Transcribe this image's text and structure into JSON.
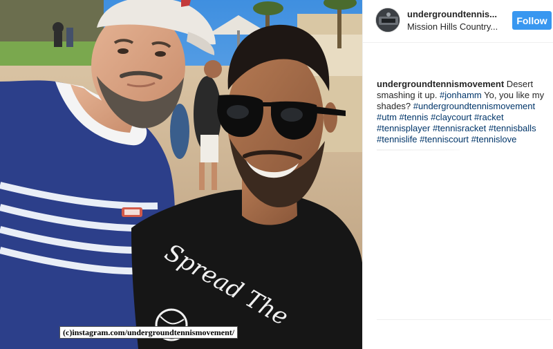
{
  "photo": {
    "watermark": "(c)instagram.com/undergroundtennismovement/",
    "shirt_text": "Spread The"
  },
  "post": {
    "username": "undergroundtennis...",
    "location": "Mission Hills Country...",
    "follow_label": "Follow",
    "caption": {
      "username": "undergroundtennismovement",
      "text_1": " Desert smashing it up. ",
      "tag_1": "#jonhamm",
      "text_2": " Yo, you like my shades? ",
      "hashtags": [
        "#undergroundtennismovement",
        "#utm",
        "#tennis",
        "#claycourt",
        "#racket",
        "#tennisplayer",
        "#tennisracket",
        "#tennisballs",
        "#tennislife",
        "#tenniscourt",
        "#tennislove"
      ]
    }
  },
  "colors": {
    "follow_button": "#3897f0",
    "hashtag": "#003569",
    "text": "#262626"
  }
}
